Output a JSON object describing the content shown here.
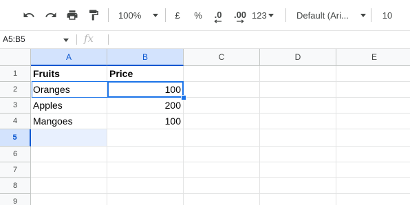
{
  "toolbar": {
    "icons": [
      "undo-icon",
      "redo-icon",
      "print-icon",
      "paint-format-icon"
    ],
    "zoom": "100%",
    "currency_symbol": "£",
    "percent_symbol": "%",
    "decrease_decimal": ".0",
    "increase_decimal": ".00",
    "more_formats": "123",
    "font_family": "Default (Ari...",
    "font_size": "10"
  },
  "formula_bar": {
    "name_box": "A5:B5",
    "fx_symbol": "fx",
    "value": ""
  },
  "grid": {
    "columns": [
      "A",
      "B",
      "C",
      "D",
      "E"
    ],
    "rows": [
      "1",
      "2",
      "3",
      "4",
      "5",
      "6",
      "7",
      "8",
      "9"
    ],
    "cells": {
      "A1": "Fruits",
      "B1": "Price",
      "A2": "Oranges",
      "B2": "100",
      "A3": "Apples",
      "B3": "200",
      "A4": "Mangoes",
      "B4": "100"
    },
    "selection": "A5:B5",
    "active_cell": "B5"
  },
  "colors": {
    "selection_border": "#1a73e8",
    "selection_fill": "#e8f0fe",
    "header_selected_fill": "#d3e3fd",
    "header_selected_text": "#0b57d0"
  }
}
